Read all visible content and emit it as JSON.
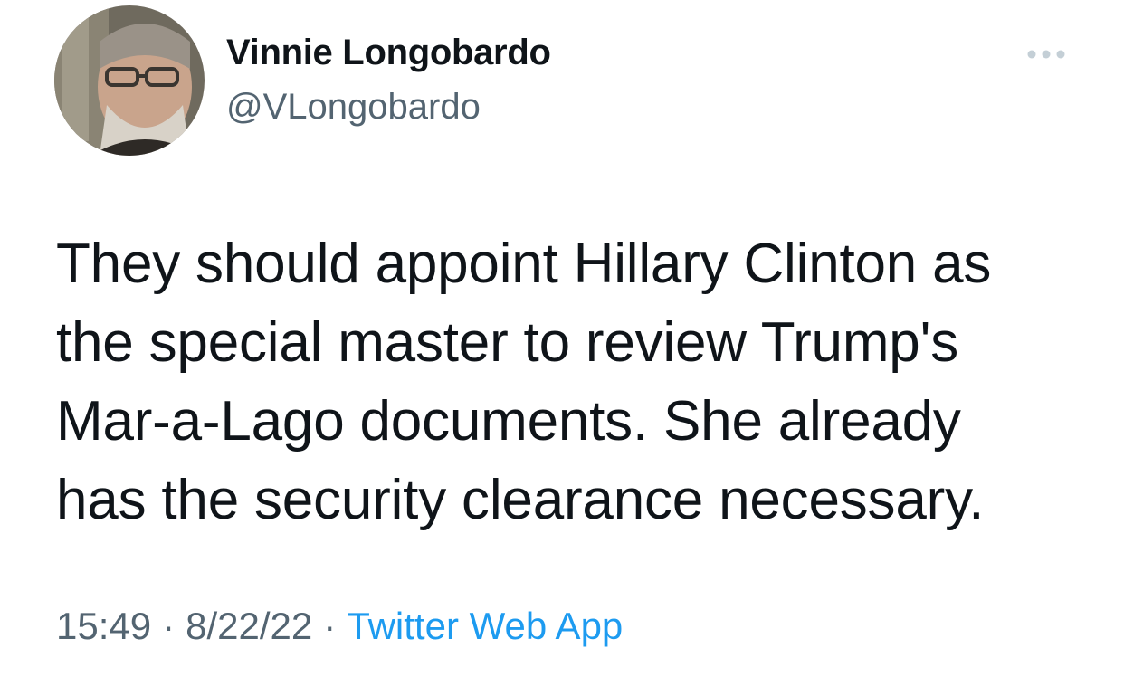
{
  "author": {
    "display_name": "Vinnie Longobardo",
    "handle": "@VLongobardo",
    "avatar_icon": "profile-photo"
  },
  "tweet": {
    "lines": [
      "They should appoint Hillary Clinton as",
      "the special master to review Trump's",
      "Mar-a-Lago documents. She already",
      "has the security clearance necessary."
    ]
  },
  "meta": {
    "time": "15:49",
    "separator": "·",
    "date": "8/22/22",
    "source": "Twitter Web App"
  },
  "colors": {
    "text_primary": "#0f1419",
    "text_secondary": "#536471",
    "link": "#1d9bf0"
  },
  "icons": {
    "more": "more-dots-icon"
  }
}
